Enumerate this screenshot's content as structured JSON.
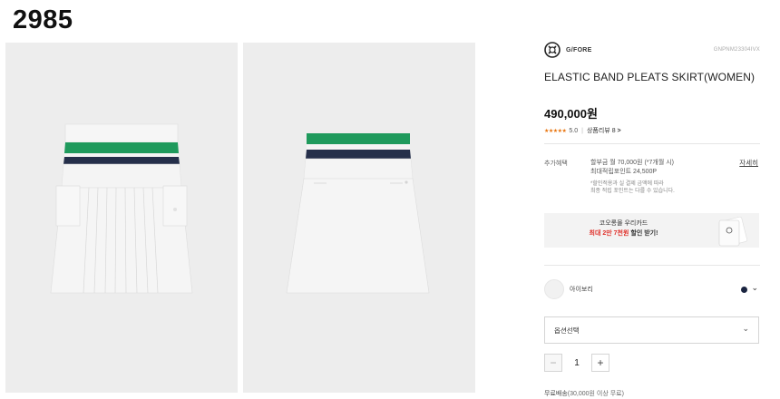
{
  "listing_number": "2985",
  "product": {
    "brand": "G/FORE",
    "sku": "GNPNM23304IVX",
    "title": "ELASTIC BAND PLEATS SKIRT(WOMEN)",
    "price": "490,000원",
    "rating_stars": "★★★★★",
    "rating_value": "5.0",
    "review_label": "상품리뷰",
    "review_count": "8",
    "review_chevron": ">"
  },
  "benefit": {
    "label": "추가혜택",
    "installment": "할부금 월 70,000원 (*7개월 시)",
    "points": "최대적립포인트 24,500P",
    "note_line1": "*할인적용과 실 결제 금액에 따라",
    "note_line2": "최종 적립 포인트는 다를 수 있습니다.",
    "detail_link": "자세히"
  },
  "card_banner": {
    "line1": "코오롱몰 우리카드",
    "highlight": "최대 2만 7천원",
    "tail": "할인 받기!"
  },
  "color_option": {
    "label": "아이보리",
    "swatch_color": "#f1f1f1",
    "selected_dot_color": "#1a2440"
  },
  "option_select": {
    "label": "옵션선택"
  },
  "quantity": {
    "minus": "−",
    "value": "1",
    "plus": "+"
  },
  "shipping": {
    "label": "무료배송",
    "condition": "(30,000원 이상 무료)"
  },
  "colors": {
    "stripe_green": "#1f9a5c",
    "stripe_navy": "#252f4a",
    "star_orange": "#e8730c",
    "highlight_red": "#e0312b"
  },
  "icons": {
    "chevron_down": "chevron-down-icon",
    "brand_logo": "gfore-logo-icon"
  }
}
